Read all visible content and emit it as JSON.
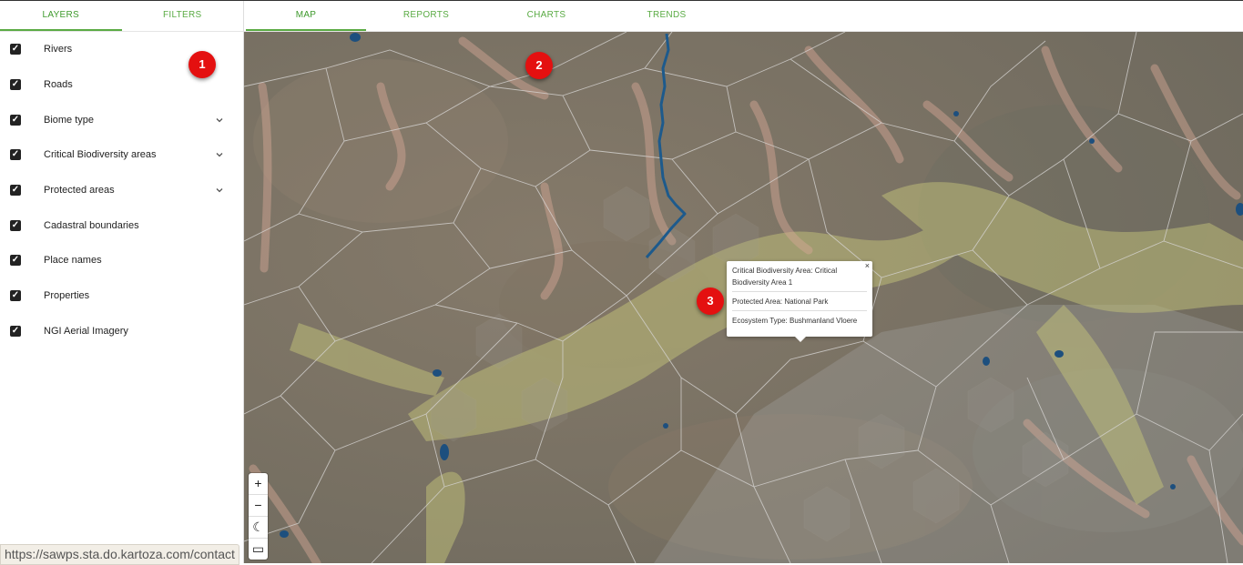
{
  "sidebar": {
    "tabs": [
      {
        "label": "LAYERS",
        "active": true
      },
      {
        "label": "FILTERS",
        "active": false
      }
    ],
    "layers": [
      {
        "label": "Rivers",
        "checked": true,
        "expandable": false
      },
      {
        "label": "Roads",
        "checked": true,
        "expandable": false
      },
      {
        "label": "Biome type",
        "checked": true,
        "expandable": true
      },
      {
        "label": "Critical Biodiversity areas",
        "checked": true,
        "expandable": true
      },
      {
        "label": "Protected areas",
        "checked": true,
        "expandable": true
      },
      {
        "label": "Cadastral boundaries",
        "checked": true,
        "expandable": false
      },
      {
        "label": "Place names",
        "checked": true,
        "expandable": false
      },
      {
        "label": "Properties",
        "checked": true,
        "expandable": false
      },
      {
        "label": "NGI Aerial Imagery",
        "checked": true,
        "expandable": false
      }
    ]
  },
  "nav": {
    "tabs": [
      {
        "label": "MAP",
        "active": true
      },
      {
        "label": "REPORTS",
        "active": false
      },
      {
        "label": "CHARTS",
        "active": false
      },
      {
        "label": "TRENDS",
        "active": false
      }
    ]
  },
  "popup": {
    "close": "×",
    "rows": [
      "Critical Biodiversity Area: Critical Biodiversity Area 1",
      "Protected Area: National Park",
      "Ecosystem Type: Bushmanland Vloere"
    ]
  },
  "markers": [
    "1",
    "2",
    "3"
  ],
  "zoom": {
    "in": "+",
    "out": "−",
    "theme": "☾",
    "extra": "▭"
  },
  "status_url": "https://sawps.sta.do.kartoza.com/contact",
  "colors": {
    "accent": "#5aab44",
    "marker": "#e41010",
    "river": "#1d5a8c"
  }
}
